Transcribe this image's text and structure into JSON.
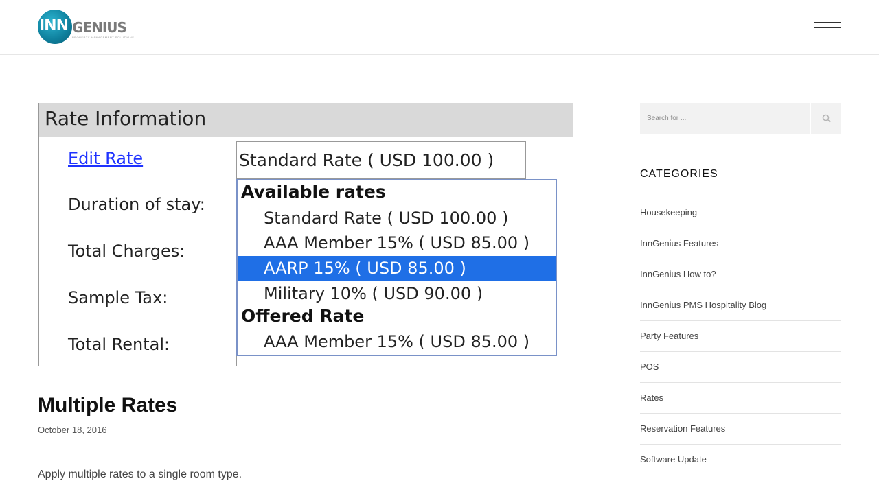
{
  "header": {
    "logo": {
      "inn": "INN",
      "genius": "GENIUS",
      "tagline": "PROPERTY MANAGEMENT SOLUTIONS"
    },
    "menu_icon": "hamburger-menu-icon"
  },
  "featured_image": {
    "title": "Rate Information",
    "labels": [
      "Edit Rate",
      "Duration of stay:",
      "Total Charges:",
      "Sample Tax:",
      "Total Rental:"
    ],
    "selected_rate": "Standard Rate ( USD 100.00 )",
    "groups": [
      {
        "label": "Available rates",
        "options": [
          {
            "text": "Standard Rate ( USD 100.00 )",
            "selected": false
          },
          {
            "text": "AAA Member 15% ( USD 85.00 )",
            "selected": false
          },
          {
            "text": "AARP 15% ( USD 85.00 )",
            "selected": true
          },
          {
            "text": "Military 10% ( USD 90.00 )",
            "selected": false
          }
        ]
      },
      {
        "label": "Offered Rate",
        "options": [
          {
            "text": "AAA Member 15% ( USD 85.00 )",
            "selected": false
          }
        ]
      }
    ]
  },
  "post": {
    "title": "Multiple Rates",
    "date": "October 18, 2016",
    "excerpt": "Apply multiple rates to a single room type."
  },
  "sidebar": {
    "search": {
      "placeholder": "Search for ...",
      "icon": "search-icon"
    },
    "categories_heading": "CATEGORIES",
    "categories": [
      "Housekeeping",
      "InnGenius Features",
      "InnGenius How to?",
      "InnGenius PMS Hospitality Blog",
      "Party Features",
      "POS",
      "Rates",
      "Reservation Features",
      "Software Update"
    ]
  },
  "colors": {
    "accent_blue": "#1f6fe6",
    "logo_teal": "#0e7f9c",
    "link_blue": "#1f33ff"
  }
}
